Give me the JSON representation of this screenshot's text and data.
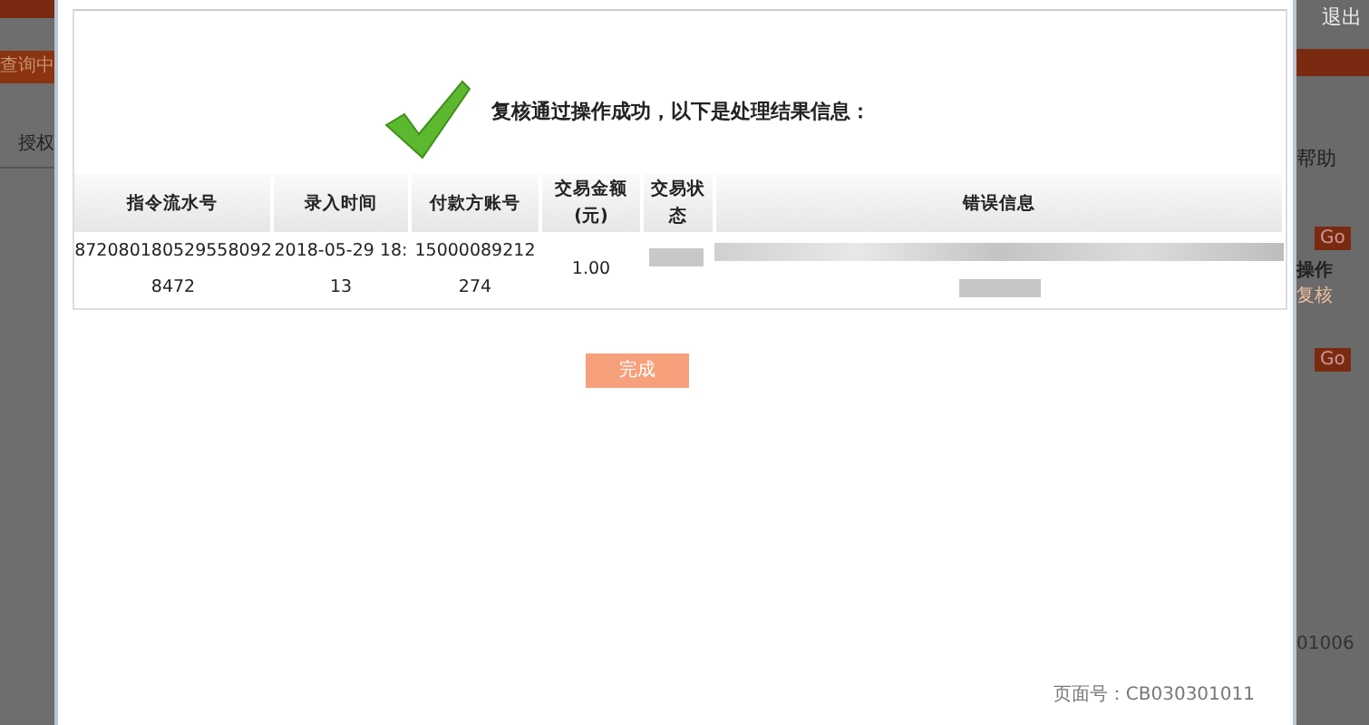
{
  "background_left": {
    "items": [
      "查询中",
      "授权"
    ]
  },
  "background_right": {
    "logout": "退出",
    "help": "帮助",
    "buttons": [
      "Go",
      "Go"
    ],
    "operation_header": "操作",
    "review_link": "复核",
    "code_fragment": "01006"
  },
  "dialog": {
    "message": "复核通过操作成功，以下是处理结果信息：",
    "table": {
      "columns": [
        "指令流水号",
        "录入时间",
        "付款方账号",
        "交易金额(元)",
        "交易状态",
        "错误信息"
      ],
      "rows": [
        {
          "cells": [
            "8720801805295580928472",
            "2018-05-29 18:13",
            "15000089212274",
            "1.00"
          ],
          "status_blurred": true,
          "error_blurred": true
        }
      ]
    },
    "done_button": "完成",
    "page_number": "页面号：CB030301011"
  }
}
